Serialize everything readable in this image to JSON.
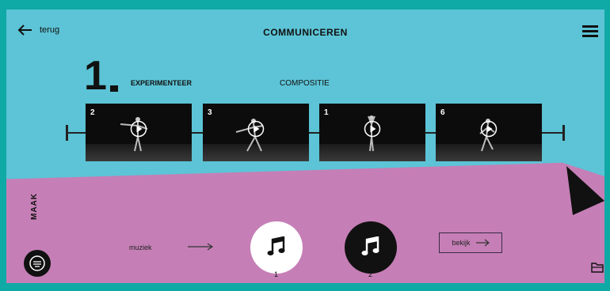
{
  "header": {
    "back_label": "terug",
    "title": "COMMUNICEREN"
  },
  "step": {
    "number": "1",
    "tabs": [
      {
        "label": "EXPERIMENTEER",
        "active": true
      },
      {
        "label": "COMPOSITIE",
        "active": false
      }
    ]
  },
  "timeline": {
    "clips": [
      {
        "number": "2"
      },
      {
        "number": "3"
      },
      {
        "number": "1"
      },
      {
        "number": "6"
      }
    ]
  },
  "maak": {
    "label": "MAAK",
    "music_label": "muziek",
    "note_buttons": [
      {
        "label": "1"
      },
      {
        "label": "2"
      }
    ],
    "view_button": "bekijk"
  },
  "colors": {
    "background": "#0fa9a6",
    "top_band": "#5cc4d6",
    "bottom_band": "#c57fb6",
    "dark": "#111111"
  },
  "icons": [
    "back-arrow-icon",
    "menu-icon",
    "play-icon",
    "music-note-icon",
    "arrow-right-icon",
    "folder-icon"
  ]
}
